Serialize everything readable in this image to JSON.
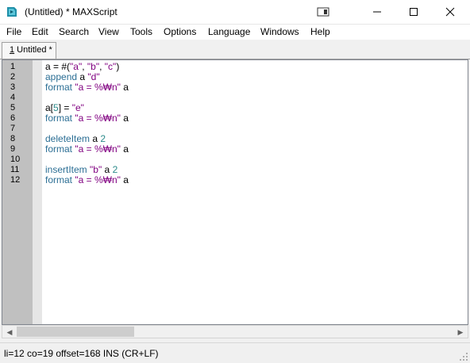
{
  "window": {
    "title": "(Untitled) * MAXScript",
    "minimize_icon": "minimize-icon",
    "maximize_icon": "maximize-icon",
    "close_icon": "close-icon"
  },
  "menu": {
    "items": [
      "File",
      "Edit",
      "Search",
      "View",
      "Tools",
      "Options",
      "Language",
      "Windows",
      "Help"
    ]
  },
  "tabs": [
    {
      "label_prefix": "1",
      "label_rest": " Untitled *"
    }
  ],
  "editor": {
    "line_numbers": [
      "1",
      "2",
      "3",
      "4",
      "5",
      "6",
      "7",
      "8",
      "9",
      "10",
      "11",
      "12"
    ],
    "lines": [
      [
        {
          "t": "a = #(",
          "c": "plain"
        },
        {
          "t": "\"a\"",
          "c": "str"
        },
        {
          "t": ", ",
          "c": "plain"
        },
        {
          "t": "\"b\"",
          "c": "str"
        },
        {
          "t": ", ",
          "c": "plain"
        },
        {
          "t": "\"c\"",
          "c": "str"
        },
        {
          "t": ")",
          "c": "plain"
        }
      ],
      [
        {
          "t": "append ",
          "c": "kw"
        },
        {
          "t": "a ",
          "c": "plain"
        },
        {
          "t": "\"d\"",
          "c": "str"
        }
      ],
      [
        {
          "t": "format ",
          "c": "kw"
        },
        {
          "t": "\"a = %₩n\"",
          "c": "str"
        },
        {
          "t": " a",
          "c": "plain"
        }
      ],
      [],
      [
        {
          "t": "a[",
          "c": "plain"
        },
        {
          "t": "5",
          "c": "num"
        },
        {
          "t": "] = ",
          "c": "plain"
        },
        {
          "t": "\"e\"",
          "c": "str"
        }
      ],
      [
        {
          "t": "format ",
          "c": "kw"
        },
        {
          "t": "\"a = %₩n\"",
          "c": "str"
        },
        {
          "t": " a",
          "c": "plain"
        }
      ],
      [],
      [
        {
          "t": "deleteItem ",
          "c": "kw"
        },
        {
          "t": "a ",
          "c": "plain"
        },
        {
          "t": "2",
          "c": "num"
        }
      ],
      [
        {
          "t": "format ",
          "c": "kw"
        },
        {
          "t": "\"a = %₩n\"",
          "c": "str"
        },
        {
          "t": " a",
          "c": "plain"
        }
      ],
      [],
      [
        {
          "t": "insertItem ",
          "c": "kw"
        },
        {
          "t": "\"b\"",
          "c": "str"
        },
        {
          "t": " a ",
          "c": "plain"
        },
        {
          "t": "2",
          "c": "num"
        }
      ],
      [
        {
          "t": "format ",
          "c": "kw"
        },
        {
          "t": "\"a = %₩n\"",
          "c": "str"
        },
        {
          "t": " a",
          "c": "plain"
        }
      ]
    ]
  },
  "status": {
    "text": "li=12 co=19 offset=168 INS (CR+LF)"
  },
  "colors": {
    "keyword": "#2b6e94",
    "string": "#800080",
    "number": "#2b8a8a",
    "gutter": "#c0c0c0"
  }
}
